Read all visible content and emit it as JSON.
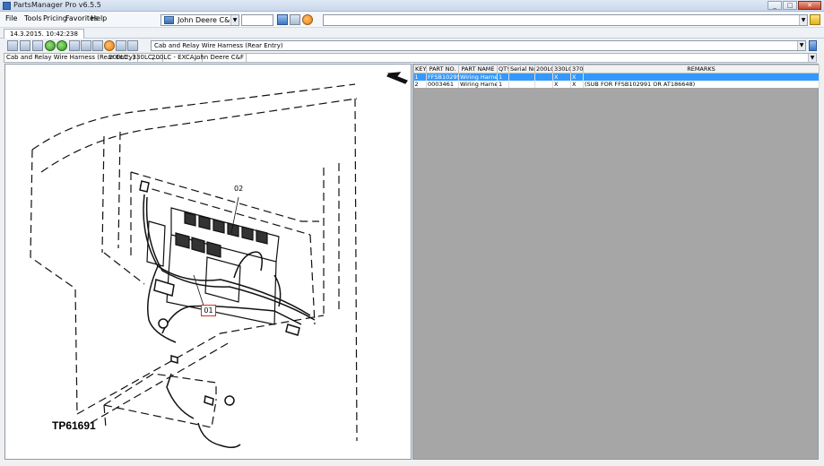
{
  "window": {
    "title": "PartsManager Pro v6.5.5"
  },
  "menu": [
    "File",
    "Tools",
    "Pricing",
    "Favorites",
    "Help"
  ],
  "dealer_select": {
    "value": "John Deere C&F"
  },
  "tab": {
    "label": "14.3.2015. 10:42:238"
  },
  "assembly_select": {
    "value": "Cab and Relay Wire Harness (Rear Entry)"
  },
  "breadcrumb": [
    "Cab and Relay Wire Harness (Rear Entry)",
    "200LC, 330LC,...",
    "200LC - EXCA...",
    "John Deere C&F"
  ],
  "drawing": {
    "figure_id": "TP61691",
    "callouts": [
      "01",
      "02"
    ]
  },
  "parts_table": {
    "columns": [
      "KEY",
      "PART NO.",
      "PART NAME",
      "QTY",
      "Serial No.",
      "200LC",
      "330LC",
      "370",
      "REMARKS"
    ],
    "rows": [
      {
        "key": "1",
        "part_no": "FFSB102990",
        "part_name": "Wiring Harness",
        "qty": "1",
        "serial": "",
        "c200": "",
        "c330": "X",
        "c370": "X",
        "remarks": ""
      },
      {
        "key": "2",
        "part_no": "0003461",
        "part_name": "Wiring Harness",
        "qty": "1",
        "serial": "",
        "c200": "",
        "c330": "X",
        "c370": "X",
        "remarks": "(SUB FOR FFSB102991 OR AT186648)"
      }
    ]
  },
  "colors": {
    "selection": "#3399ff",
    "pane_background": "#a6a6a6"
  }
}
